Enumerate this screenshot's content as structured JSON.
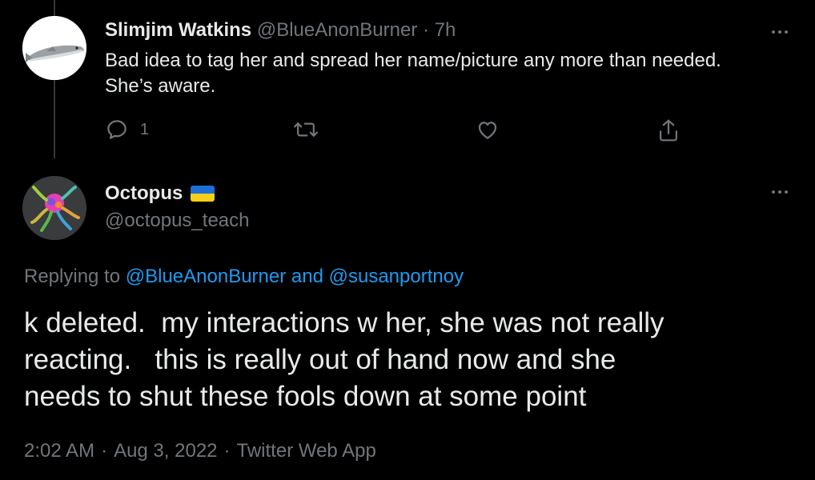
{
  "tweet1": {
    "display_name": "Slimjim Watkins",
    "handle": "@BlueAnonBurner",
    "separator": "·",
    "time": "7h",
    "body_line1": "Bad idea to tag her and spread her name/picture any more than needed.",
    "body_line2": "She’s aware.",
    "reply_count": "1",
    "avatar_icon": "salmon-fish-icon"
  },
  "tweet2": {
    "display_name": "Octopus",
    "flag_icon": "ukraine-flag-icon",
    "handle": "@octopus_teach",
    "avatar_icon": "octopus-icon",
    "replying_prefix": "Replying to",
    "replying_mention1": "@BlueAnonBurner",
    "replying_and": "and",
    "replying_mention2": "@susanportnoy",
    "body_line1": "k deleted.  my interactions w her, she was not really",
    "body_line2": "reacting.   this is really out of hand now and she",
    "body_line3": "needs to shut these fools down at some point",
    "time": "2:02 AM",
    "date": "Aug 3, 2022",
    "source": "Twitter Web App",
    "meta_separator": "·"
  },
  "colors": {
    "background": "#000000",
    "primary_text": "#e7e9ea",
    "secondary_text": "#71767b",
    "accent": "#1d9bf0",
    "flag_blue": "#1d6fd6",
    "flag_yellow": "#f5cf1c"
  }
}
